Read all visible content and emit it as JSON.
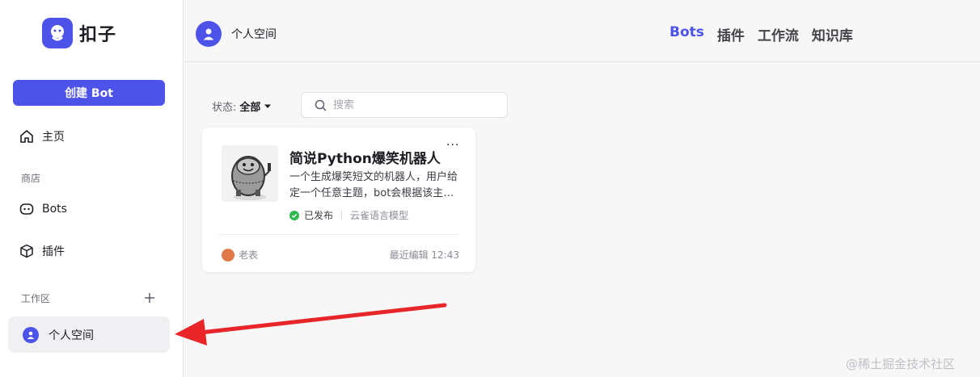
{
  "brand": {
    "name": "扣子"
  },
  "sidebar": {
    "create_label": "创建 Bot",
    "home_label": "主页",
    "store_section": "商店",
    "bots_label": "Bots",
    "plugins_label": "插件",
    "workspace_section": "工作区",
    "personal_label": "个人空间"
  },
  "header": {
    "space_name": "个人空间",
    "tabs": [
      "Bots",
      "插件",
      "工作流",
      "知识库"
    ],
    "active_tab": "Bots"
  },
  "filters": {
    "status_label": "状态:",
    "status_value": "全部",
    "search_placeholder": "搜索"
  },
  "bot_card": {
    "title": "简说Python爆笑机器人",
    "description": "一个生成爆笑短文的机器人，用户给定一个任意主题，bot会根据该主题生成爆笑短文",
    "status": "已发布",
    "model": "云雀语言模型",
    "author": "老表",
    "edited": "最近编辑 12:43",
    "more": "···"
  },
  "watermark": "@稀土掘金技术社区",
  "colors": {
    "accent": "#4d53e8",
    "published": "#2db84d",
    "arrow": "#e8262a"
  }
}
